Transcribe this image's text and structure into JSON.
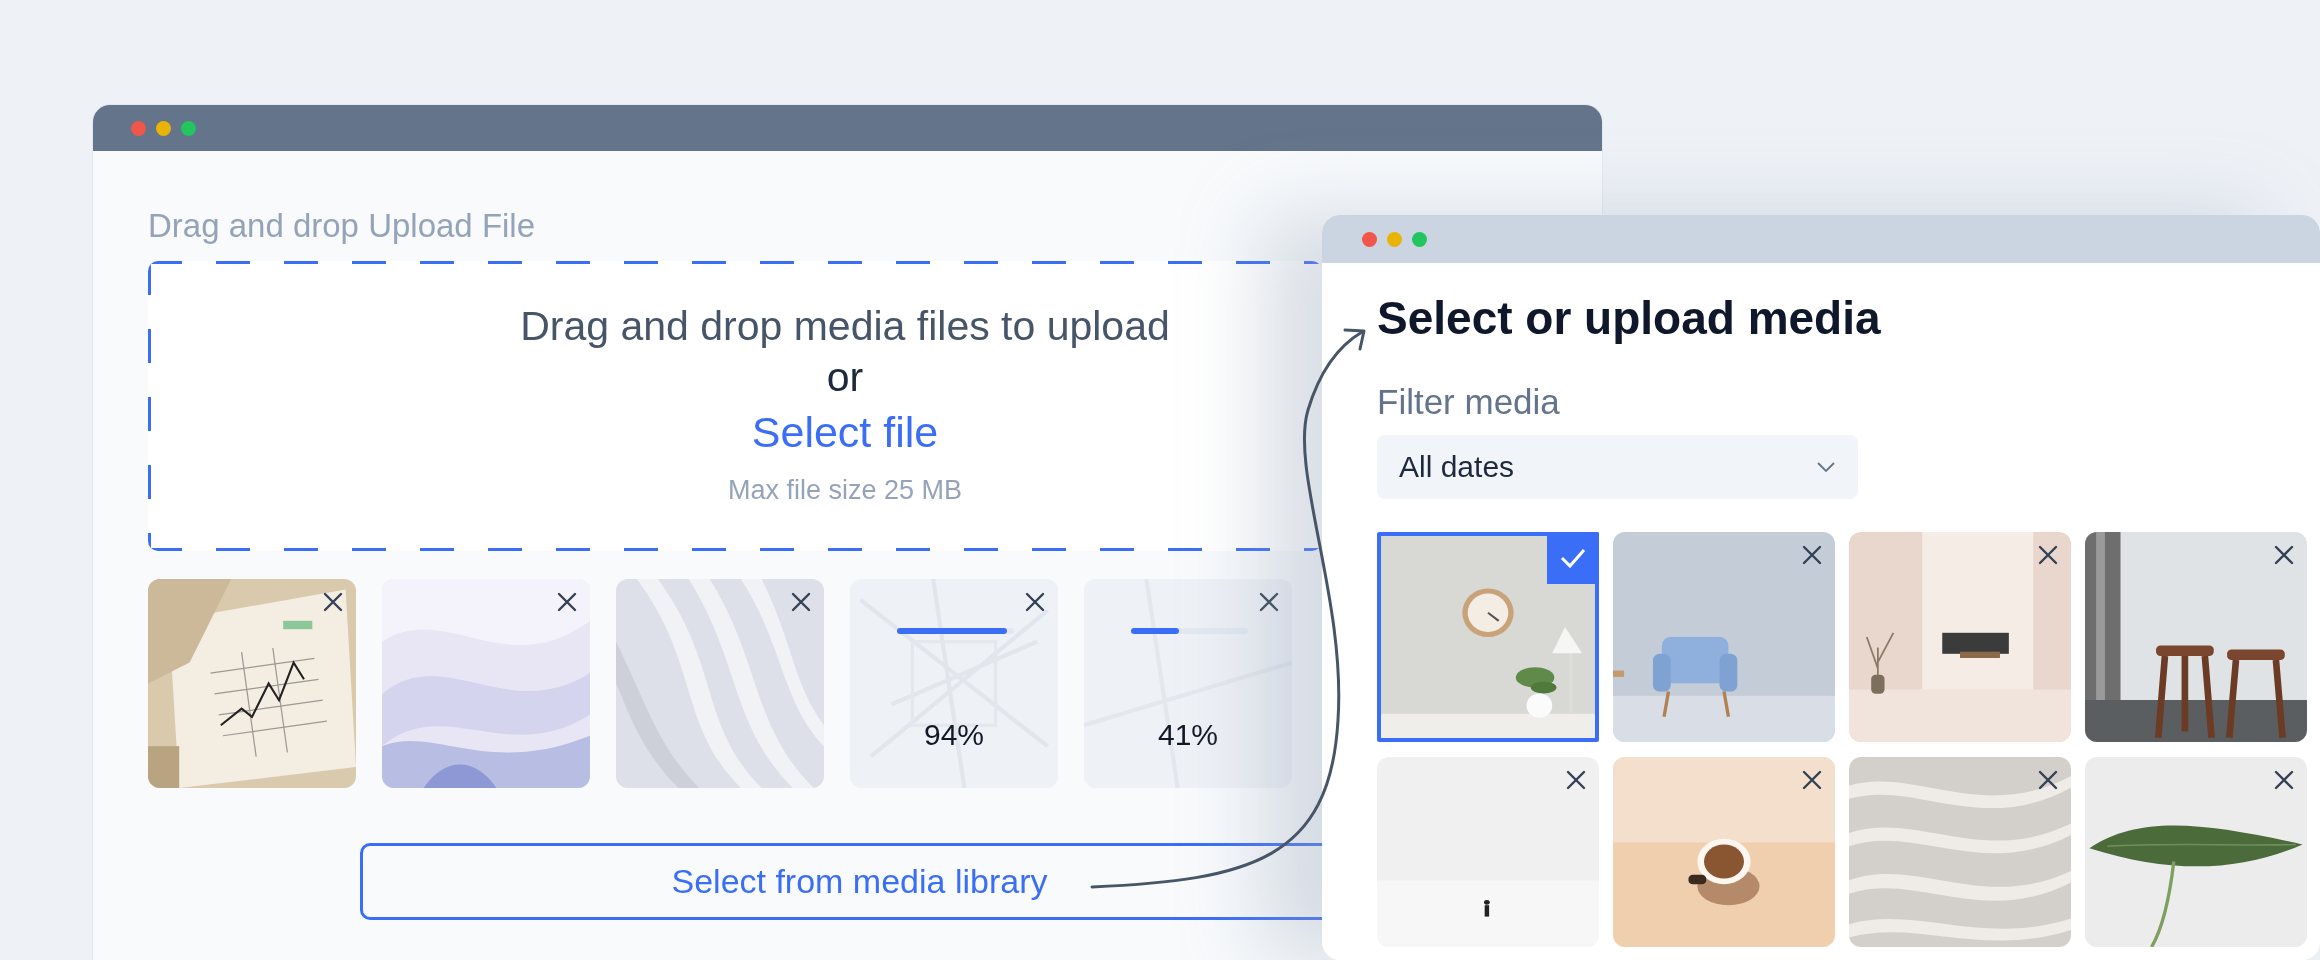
{
  "upload_window": {
    "heading": "Drag and drop Upload File",
    "dropzone": {
      "prompt": "Drag and drop media files to upload",
      "separator": "or",
      "link": "Select file",
      "hint": "Max file size 25 MB"
    },
    "files": [
      {
        "kind": "picture"
      },
      {
        "kind": "picture"
      },
      {
        "kind": "picture"
      },
      {
        "kind": "progress",
        "level": 0.94,
        "reading": "94%"
      },
      {
        "kind": "progress",
        "level": 0.41,
        "reading": "41%"
      }
    ],
    "library_button": "Select from media library"
  },
  "media_window": {
    "title": "Select or upload media",
    "filter_label": "Filter media",
    "filter_value": "All dates",
    "items": [
      {
        "selected": true
      },
      {
        "selected": false
      },
      {
        "selected": false
      },
      {
        "selected": false
      },
      {
        "selected": false
      },
      {
        "selected": false
      },
      {
        "selected": false
      },
      {
        "selected": false
      }
    ]
  }
}
